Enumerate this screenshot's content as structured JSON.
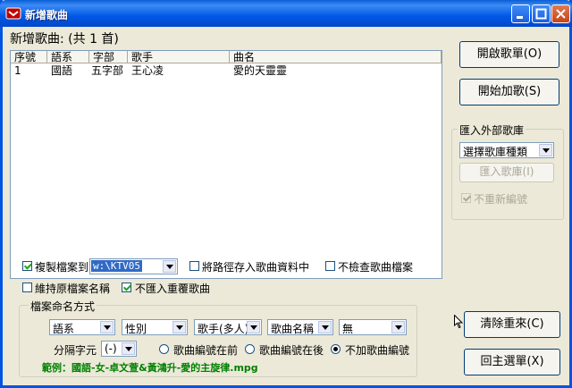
{
  "window": {
    "title": "新增歌曲"
  },
  "heading": "新增歌曲: (共 1 首)",
  "table": {
    "headers": [
      "序號",
      "語系",
      "字部",
      "歌手",
      "曲名"
    ],
    "rows": [
      [
        "1",
        "國語",
        "五字部",
        "王心凌",
        "愛的天靈靈"
      ]
    ]
  },
  "buttons": {
    "open_songlist": "開啟歌單(O)",
    "start_add": "開始加歌(S)",
    "clear_restart": "清除重來(C)",
    "back_main": "回主選單(X)",
    "import_songs": "匯入歌庫(I)"
  },
  "import_group": {
    "title": "匯入外部歌庫",
    "select_value": "選擇歌庫種類",
    "no_renumber": "不重新編號"
  },
  "options": {
    "copy_files_to": "複製檔案到",
    "copy_path_value": "w:\\KTV05",
    "save_path": "將路徑存入歌曲資料中",
    "no_check_files": "不檢查歌曲檔案",
    "keep_original_name": "維持原檔案名稱",
    "no_import_duplicates": "不匯入重覆歌曲"
  },
  "naming": {
    "title": "檔案命名方式",
    "fields": [
      "語系",
      "性別",
      "歌手(多人)",
      "歌曲名稱",
      "無"
    ],
    "separator_label": "分隔字元",
    "separator_value": "(-)",
    "radio_number_first": "歌曲編號在前",
    "radio_number_last": "歌曲編號在後",
    "radio_no_number": "不加歌曲編號",
    "example": "範例：國語-女-卓文萱&黃鴻升-愛的主旋律.mpg"
  }
}
